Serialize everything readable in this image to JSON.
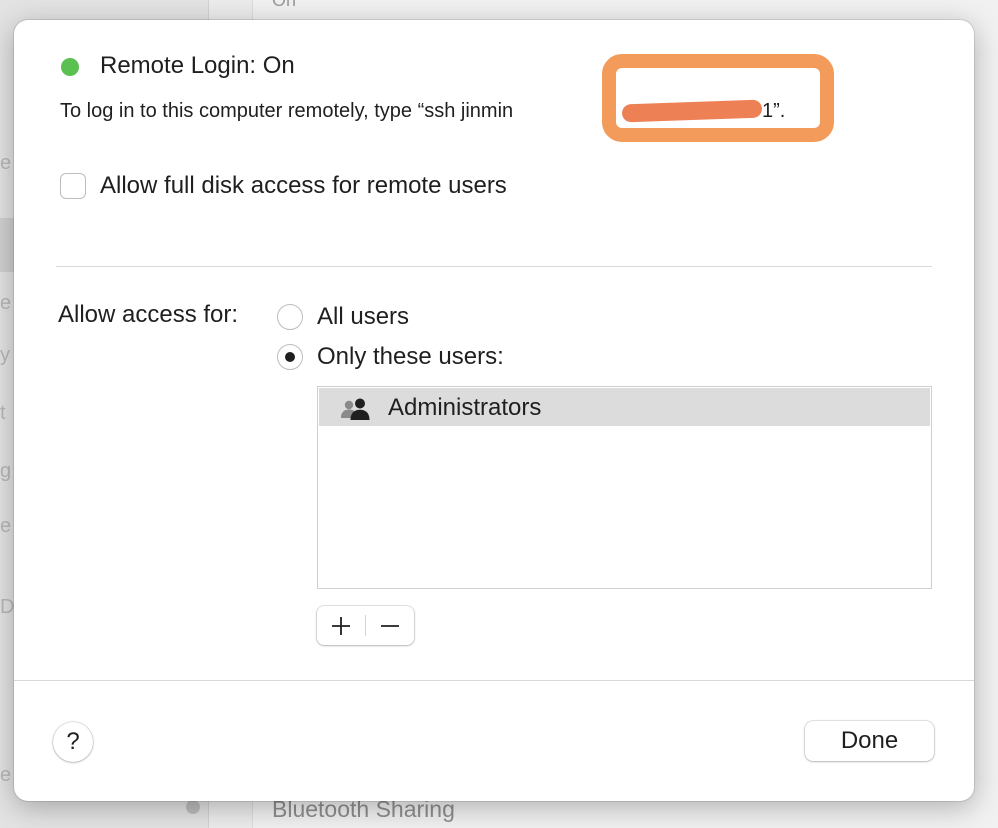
{
  "background": {
    "top_row_text": "On",
    "sidebar_letters": [
      "e",
      "e",
      "y",
      "t",
      "g",
      "e",
      "D",
      "e"
    ],
    "bottom_item_label": "Bluetooth Sharing"
  },
  "sheet": {
    "service_title": "Remote Login: On",
    "status_color": "#5ac04f",
    "instructions_visible": "To log in to this computer remotely, type “ssh jinmin",
    "instructions_tail": "1”.",
    "redaction_color": "#f39b5b",
    "full_disk_access_label": "Allow full disk access for remote users",
    "full_disk_access_checked": false,
    "access_label": "Allow access for:",
    "radio_all_label": "All users",
    "radio_only_label": "Only these users:",
    "selected_radio": "only",
    "users": [
      {
        "name": "Administrators",
        "icon": "group-icon",
        "selected": true
      }
    ],
    "add_button_icon": "plus-icon",
    "remove_button_icon": "minus-icon",
    "help_label": "?",
    "done_label": "Done"
  }
}
